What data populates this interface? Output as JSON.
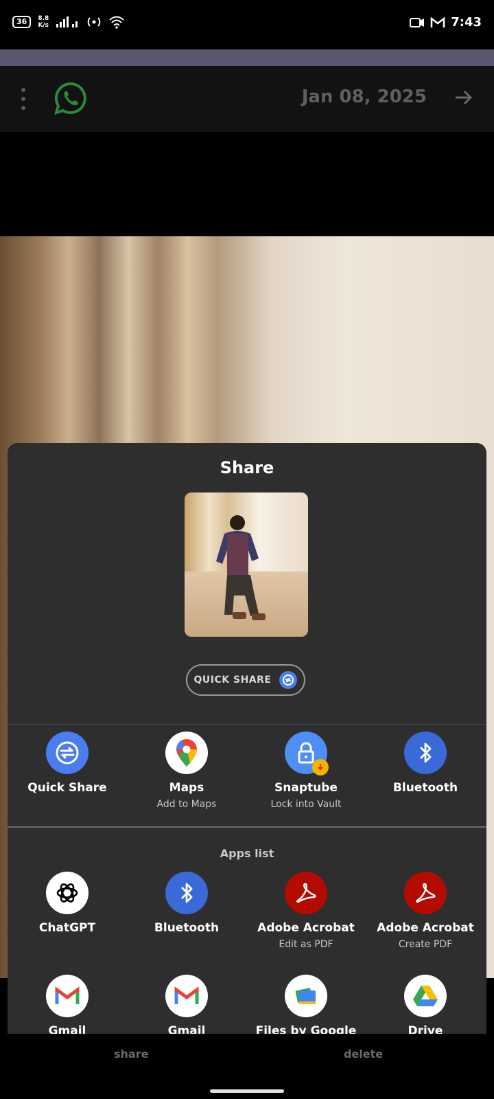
{
  "status_bar": {
    "battery": "36",
    "speed_value": "8.8",
    "speed_unit": "K/s",
    "time": "7:43"
  },
  "header": {
    "date": "Jan 08, 2025"
  },
  "share_sheet": {
    "title": "Share",
    "quick_share_button": "QUICK SHARE",
    "direct_targets": [
      {
        "label": "Quick Share",
        "sub": "",
        "icon": "quick-share-icon",
        "color": "#4a7df0"
      },
      {
        "label": "Maps",
        "sub": "Add to Maps",
        "icon": "maps-icon",
        "color": "#ffffff"
      },
      {
        "label": "Snaptube",
        "sub": "Lock into Vault",
        "icon": "lock-icon",
        "color": "#4f8ef5"
      },
      {
        "label": "Bluetooth",
        "sub": "",
        "icon": "bluetooth-icon",
        "color": "#3a6ad8"
      }
    ],
    "apps_header": "Apps list",
    "apps": [
      {
        "label": "ChatGPT",
        "sub": "",
        "icon": "chatgpt-icon"
      },
      {
        "label": "Bluetooth",
        "sub": "",
        "icon": "bluetooth-icon"
      },
      {
        "label": "Adobe Acrobat",
        "sub": "Edit as PDF",
        "icon": "adobe-acrobat-icon"
      },
      {
        "label": "Adobe Acrobat",
        "sub": "Create PDF",
        "icon": "adobe-acrobat-icon"
      }
    ],
    "apps_row2": [
      {
        "label": "Gmail",
        "icon": "gmail-icon"
      },
      {
        "label": "Gmail",
        "icon": "gmail-icon"
      },
      {
        "label": "Files by Google",
        "icon": "files-icon"
      },
      {
        "label": "Drive",
        "icon": "drive-icon"
      }
    ]
  },
  "bottom_nav": {
    "share": "share",
    "delete": "delete"
  }
}
